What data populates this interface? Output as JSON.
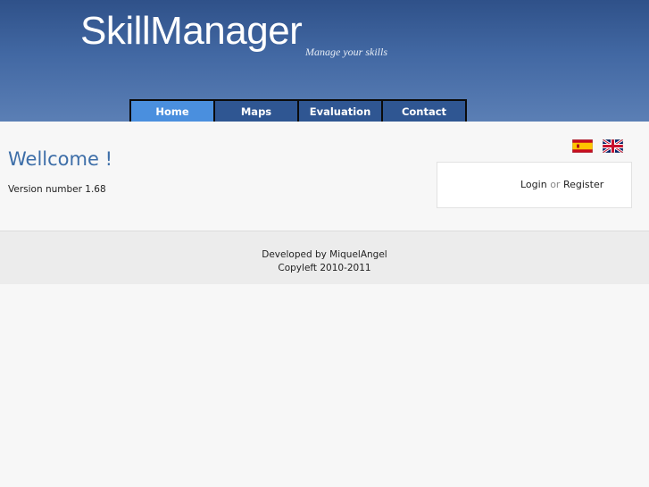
{
  "header": {
    "site_title": "SkillManager",
    "tagline": "Manage your skills",
    "gradient_top": "#2f5189",
    "gradient_bottom": "#5b7fb5"
  },
  "nav": {
    "items": [
      {
        "label": "Home",
        "active": true
      },
      {
        "label": "Maps",
        "active": false
      },
      {
        "label": "Evaluation",
        "active": false
      },
      {
        "label": "Contact",
        "active": false
      }
    ],
    "active_color": "#4a8fde",
    "item_color": "#2f5692"
  },
  "main": {
    "welcome": "Wellcome !",
    "version_text": "Version number 1.68",
    "welcome_color": "#3d6ea8"
  },
  "languages": [
    {
      "icon": "spain-flag-icon"
    },
    {
      "icon": "uk-flag-icon"
    }
  ],
  "login": {
    "login_label": "Login",
    "or_text": "or",
    "register_label": "Register"
  },
  "footer": {
    "developed_by": "Developed by MiquelAngel",
    "copyleft": "Copyleft 2010-2011"
  }
}
